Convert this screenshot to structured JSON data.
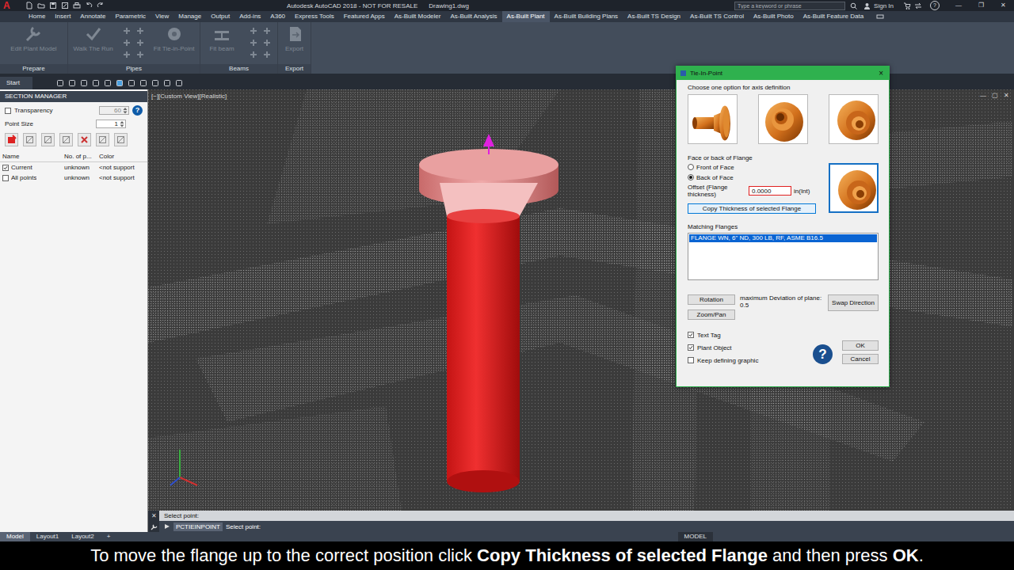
{
  "title_bar": {
    "app_letter": "A",
    "title": "Autodesk AutoCAD 2018 - NOT FOR RESALE",
    "file": "Drawing1.dwg",
    "search_placeholder": "Type a keyword or phrase",
    "user": "Sign In",
    "help": "?",
    "controls": [
      "—",
      "❐",
      "✕"
    ]
  },
  "ribbon_tabs": [
    {
      "label": "Home",
      "selected": false
    },
    {
      "label": "Insert",
      "selected": false
    },
    {
      "label": "Annotate",
      "selected": false
    },
    {
      "label": "Parametric",
      "selected": false
    },
    {
      "label": "View",
      "selected": false
    },
    {
      "label": "Manage",
      "selected": false
    },
    {
      "label": "Output",
      "selected": false
    },
    {
      "label": "Add-ins",
      "selected": false
    },
    {
      "label": "A360",
      "selected": false
    },
    {
      "label": "Express Tools",
      "selected": false
    },
    {
      "label": "Featured Apps",
      "selected": false
    },
    {
      "label": "As-Built Modeler",
      "selected": false
    },
    {
      "label": "As-Built Analysis",
      "selected": false
    },
    {
      "label": "As-Built Plant",
      "selected": true
    },
    {
      "label": "As-Built Building Plans",
      "selected": false
    },
    {
      "label": "As-Built TS Design",
      "selected": false
    },
    {
      "label": "As-Built TS Control",
      "selected": false
    },
    {
      "label": "As-Built Photo",
      "selected": false
    },
    {
      "label": "As-Built Feature Data",
      "selected": false
    }
  ],
  "ribbon": {
    "groups": [
      {
        "label": "Prepare",
        "buttons": [
          {
            "label": "Edit Plant Model",
            "disabled": true
          }
        ]
      },
      {
        "label": "Pipes",
        "buttons": [
          {
            "label": "Walk The Run",
            "disabled": true
          },
          {
            "label": "Fit Tie-in-Point",
            "disabled": true
          }
        ]
      },
      {
        "label": "Beams",
        "buttons": [
          {
            "label": "Fit beam",
            "disabled": true
          }
        ]
      },
      {
        "label": "Export",
        "buttons": [
          {
            "label": "Export",
            "disabled": true
          }
        ]
      }
    ]
  },
  "doc_tabs": [
    {
      "label": "Start",
      "selected": false
    }
  ],
  "section_manager": {
    "title": "SECTION MANAGER",
    "transparency": {
      "label": "Transparency",
      "checked": false,
      "value": "60",
      "disabled": true
    },
    "point_size": {
      "label": "Point Size",
      "value": "1"
    },
    "help": "?",
    "columns": [
      "Name",
      "No. of p...",
      "Color"
    ],
    "rows": [
      {
        "name": "Current",
        "checked": true,
        "count": "unknown",
        "color": "<not support"
      },
      {
        "name": "All points",
        "checked": false,
        "count": "unknown",
        "color": "<not support"
      }
    ]
  },
  "viewport": {
    "label": "[−][Custom View][Realistic]",
    "controls": [
      "—",
      "▢",
      "✕"
    ]
  },
  "dialog": {
    "title": "Tie-In-Point",
    "close": "×",
    "axis_label": "Choose one option for axis definition",
    "face_label": "Face or back of Flange",
    "face_options": [
      {
        "label": "Front of Face",
        "selected": false
      },
      {
        "label": "Back of Face",
        "selected": true
      }
    ],
    "offset": {
      "label": "Offset (Flange thickness)",
      "value": "0.0000",
      "unit": "in(Int)",
      "error": true
    },
    "copy_button": {
      "label": "Copy Thickness of selected Flange",
      "hovered": true
    },
    "matching_label": "Matching Flanges",
    "matching_flanges": [
      {
        "label": "FLANGE WN, 6\" ND, 300 LB, RF, ASME B16.5",
        "selected": true
      }
    ],
    "rotation_button": "Rotation",
    "zoom_button": "Zoom/Pan",
    "deviation": {
      "label": "maximum Deviation of plane:",
      "value": "0.5"
    },
    "swap_button": "Swap Direction",
    "options": [
      {
        "label": "Text Tag",
        "checked": true
      },
      {
        "label": "Plant Object",
        "checked": true
      },
      {
        "label": "Keep defining graphic",
        "checked": false
      }
    ],
    "help": "?",
    "ok": "OK",
    "cancel": "Cancel"
  },
  "command_line": {
    "close": "✕",
    "history": "Select point:",
    "command": "PCTIEINPOINT",
    "prompt": "Select point:"
  },
  "status_bar": {
    "layouts": [
      {
        "label": "Model",
        "selected": true
      },
      {
        "label": "Layout1",
        "selected": false
      },
      {
        "label": "Layout2",
        "selected": false
      }
    ],
    "add": "+",
    "mode": "MODEL"
  },
  "caption": [
    {
      "text": "To move the flange up to the correct position click ",
      "bold": false
    },
    {
      "text": "Copy Thickness of selected Flange",
      "bold": true
    },
    {
      "text": " and then press ",
      "bold": false
    },
    {
      "text": "OK",
      "bold": true
    },
    {
      "text": ".",
      "bold": false
    }
  ]
}
